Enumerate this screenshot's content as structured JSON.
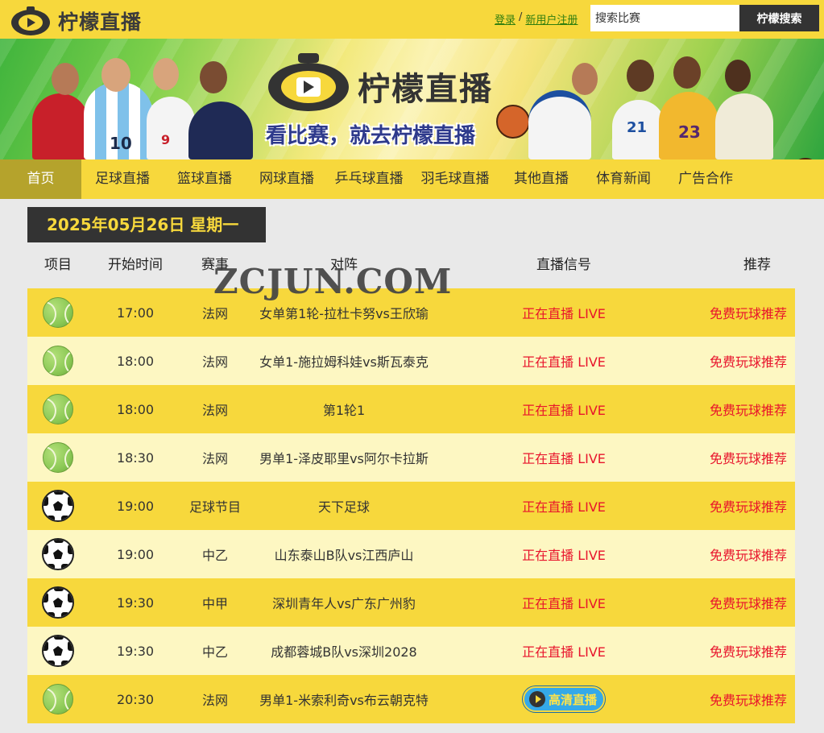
{
  "header": {
    "logo_text": "柠檬直播",
    "login": "登录",
    "sep": "/",
    "register": "新用户注册",
    "search_placeholder": "搜索比赛",
    "search_button": "柠檬搜索"
  },
  "banner": {
    "logo_text": "柠檬直播",
    "slogan": "看比赛，就去柠檬直播",
    "jersey_numbers": [
      "10",
      "9",
      "21",
      "23"
    ]
  },
  "nav": {
    "items": [
      {
        "label": "首页",
        "active": true
      },
      {
        "label": "足球直播"
      },
      {
        "label": "篮球直播"
      },
      {
        "label": "网球直播"
      },
      {
        "label": "乒乓球直播"
      },
      {
        "label": "羽毛球直播"
      },
      {
        "label": "其他直播"
      },
      {
        "label": "体育新闻"
      },
      {
        "label": "广告合作"
      }
    ]
  },
  "schedule": {
    "date": "2025年05月26日 星期一",
    "columns": [
      "项目",
      "开始时间",
      "赛事",
      "对阵",
      "直播信号",
      "推荐"
    ],
    "watermark": "ZCJUN.COM",
    "rows": [
      {
        "sport": "tennis",
        "time": "17:00",
        "event": "法网",
        "match": "女单第1轮-拉杜卡努vs王欣瑜",
        "signal": "正在直播 LIVE",
        "recommend": "免费玩球推荐"
      },
      {
        "sport": "tennis",
        "time": "18:00",
        "event": "法网",
        "match": "女单1-施拉姆科娃vs斯瓦泰克",
        "signal": "正在直播 LIVE",
        "recommend": "免费玩球推荐"
      },
      {
        "sport": "tennis",
        "time": "18:00",
        "event": "法网",
        "match": "第1轮1",
        "signal": "正在直播 LIVE",
        "recommend": "免费玩球推荐"
      },
      {
        "sport": "tennis",
        "time": "18:30",
        "event": "法网",
        "match": "男单1-泽皮耶里vs阿尔卡拉斯",
        "signal": "正在直播 LIVE",
        "recommend": "免费玩球推荐"
      },
      {
        "sport": "football",
        "time": "19:00",
        "event": "足球节目",
        "match": "天下足球",
        "signal": "正在直播 LIVE",
        "recommend": "免费玩球推荐"
      },
      {
        "sport": "football",
        "time": "19:00",
        "event": "中乙",
        "match": "山东泰山B队vs江西庐山",
        "signal": "正在直播 LIVE",
        "recommend": "免费玩球推荐"
      },
      {
        "sport": "football",
        "time": "19:30",
        "event": "中甲",
        "match": "深圳青年人vs广东广州豹",
        "signal": "正在直播 LIVE",
        "recommend": "免费玩球推荐"
      },
      {
        "sport": "football",
        "time": "19:30",
        "event": "中乙",
        "match": "成都蓉城B队vs深圳2028",
        "signal": "正在直播 LIVE",
        "recommend": "免费玩球推荐"
      },
      {
        "sport": "tennis",
        "time": "20:30",
        "event": "法网",
        "match": "男单1-米索利奇vs布云朝克特",
        "signal": "高清直播",
        "signal_type": "hd",
        "recommend": "免费玩球推荐"
      }
    ]
  },
  "colors": {
    "brand_yellow": "#f7d83c",
    "row_light": "#fdf7c2",
    "live_red": "#e8142c",
    "dark": "#333333"
  }
}
